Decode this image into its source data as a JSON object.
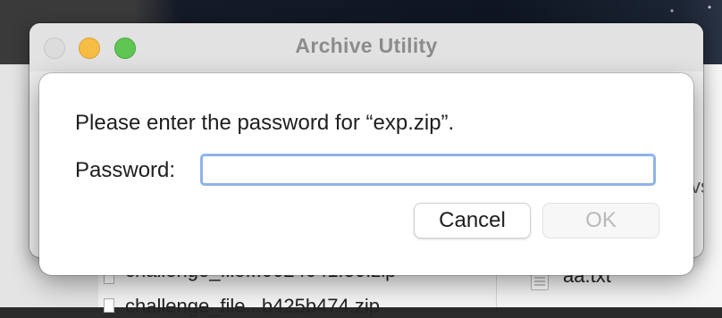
{
  "window": {
    "title": "Archive Utility"
  },
  "dialog": {
    "prompt": "Please enter the password for “exp.zip”.",
    "password_label": "Password:",
    "password_value": "",
    "cancel_label": "Cancel",
    "ok_label": "OK",
    "ok_enabled": false
  },
  "background_finder": {
    "file_1": "challenge_file...0024041f30.zip",
    "file_2": "challenge_file...b425b474.zip",
    "preview_file": "aa.txt",
    "edge_text": "vs"
  },
  "colors": {
    "close_button": "#dcdcdc",
    "minimize_button": "#f6bd44",
    "zoom_button": "#5fc553",
    "focus_ring": "#8fb2ea"
  }
}
